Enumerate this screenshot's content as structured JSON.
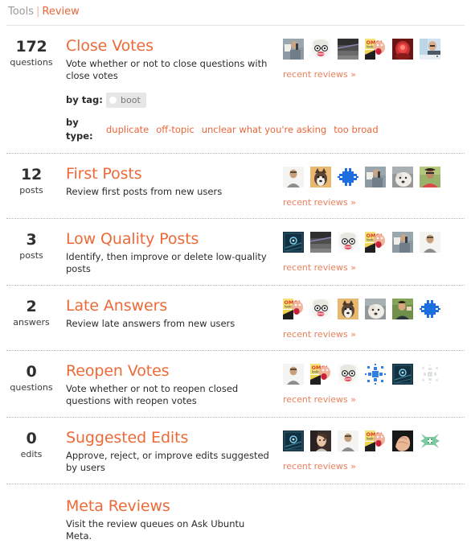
{
  "breadcrumb": {
    "parent": "Tools",
    "separator": "|",
    "current": "Review"
  },
  "queues": [
    {
      "count": "172",
      "unit": "questions",
      "title": "Close Votes",
      "description": "Vote whether or not to close questions with close votes",
      "filters": {
        "tag_label": "by tag:",
        "tags": [
          "boot"
        ],
        "type_label": "by type:",
        "types": [
          "duplicate",
          "off-topic",
          "unclear what you're asking",
          "too broad"
        ]
      },
      "recent_link": "recent reviews »",
      "avatars": [
        "man-on-phone",
        "cartoon-woman-glasses",
        "dark-gray-stripe",
        "omg-cartoon",
        "red-glow-face",
        "man-blue-shirt"
      ]
    },
    {
      "count": "12",
      "unit": "posts",
      "title": "First Posts",
      "description": "Review first posts from new users",
      "recent_link": "recent reviews »",
      "avatars": [
        "man-gray-shirt",
        "husky-dog",
        "blue-identicon",
        "man-on-phone",
        "white-dog",
        "man-red-shirt"
      ]
    },
    {
      "count": "3",
      "unit": "posts",
      "title": "Low Quality Posts",
      "description": "Identify, then improve or delete low-quality posts",
      "recent_link": "recent reviews »",
      "avatars": [
        "dark-tech-badge",
        "dark-gray-stripe",
        "cartoon-woman-glasses",
        "omg-cartoon",
        "man-on-phone",
        "man-gray-shirt"
      ]
    },
    {
      "count": "2",
      "unit": "answers",
      "title": "Late Answers",
      "description": "Review late answers from new users",
      "recent_link": "recent reviews »",
      "avatars": [
        "omg-cartoon",
        "cartoon-woman-glasses",
        "husky-dog",
        "white-dog",
        "boy-outdoors",
        "blue-identicon"
      ]
    },
    {
      "count": "0",
      "unit": "questions",
      "title": "Reopen Votes",
      "description": "Vote whether or not to reopen closed questions with reopen votes",
      "recent_link": "recent reviews »",
      "avatars": [
        "man-gray-shirt",
        "omg-cartoon",
        "cartoon-woman-glasses",
        "blue-starburst-identicon",
        "dark-tech-badge",
        "gray-faint-identicon"
      ]
    },
    {
      "count": "0",
      "unit": "edits",
      "title": "Suggested Edits",
      "description": "Approve, reject, or improve edits suggested by users",
      "recent_link": "recent reviews »",
      "avatars": [
        "dark-tech-badge",
        "woman-portrait",
        "man-gray-shirt",
        "omg-cartoon",
        "hand-closeup",
        "green-identicon"
      ]
    }
  ],
  "meta": {
    "title": "Meta Reviews",
    "description": "Visit the review queues on Ask Ubuntu Meta."
  },
  "colors": {
    "accent": "#ec6a38",
    "link": "#e8663a",
    "muted": "#9a9a9a",
    "divider": "#b9b9b9"
  }
}
